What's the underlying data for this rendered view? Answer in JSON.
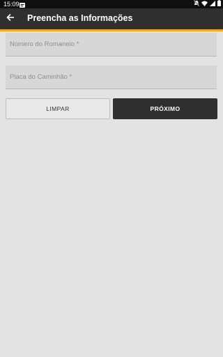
{
  "status_bar": {
    "time": "15:09",
    "icons": [
      "notification-icon",
      "mute-icon",
      "wifi-icon",
      "signal-icon",
      "battery-icon"
    ]
  },
  "app_bar": {
    "back_icon": "arrow-left-icon",
    "title": "Preencha as Informações",
    "background_color": "#2f2f2f",
    "accent_color": "#f0a726"
  },
  "form": {
    "romaneio": {
      "label": "Número do Romaneio *",
      "value": ""
    },
    "placa": {
      "label": "Placa do Caminhão *",
      "value": ""
    }
  },
  "buttons": {
    "clear_label": "LIMPAR",
    "next_label": "PRÓXIMO"
  }
}
